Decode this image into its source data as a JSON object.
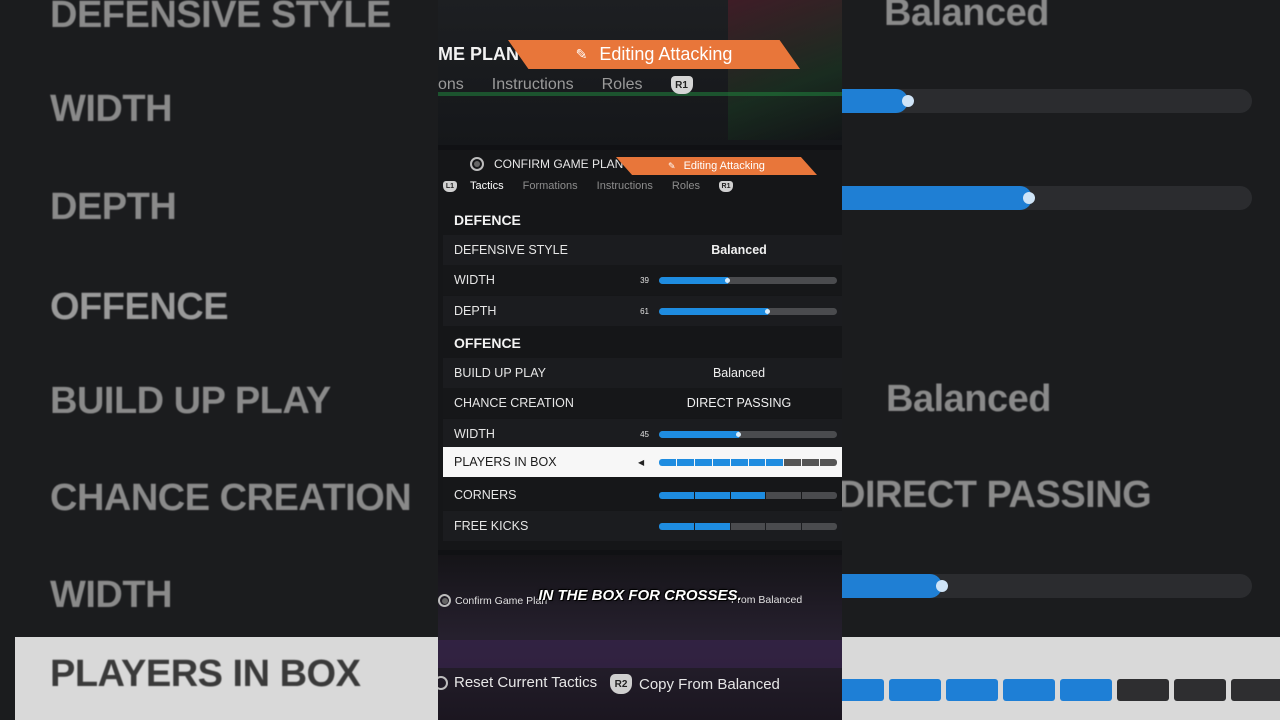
{
  "background_left": {
    "labels": [
      "DEFENSIVE STYLE",
      "WIDTH",
      "DEPTH",
      "OFFENCE",
      "BUILD UP PLAY",
      "CHANCE CREATION",
      "WIDTH",
      "PLAYERS IN BOX"
    ]
  },
  "background_right": {
    "values": [
      "Balanced",
      "Balanced",
      "DIRECT PASSING"
    ]
  },
  "top_zoom": {
    "title": "ME PLAN",
    "badge": "Editing Attacking",
    "tabs": [
      "ons",
      "Instructions",
      "Roles"
    ],
    "r1": "R1"
  },
  "header": {
    "confirm_label": "CONFIRM GAME PLAN",
    "badge": "Editing Attacking"
  },
  "tabs": {
    "l1": "L1",
    "r1": "R1",
    "items": [
      "Tactics",
      "Formations",
      "Instructions",
      "Roles"
    ],
    "active": 0
  },
  "defence": {
    "title": "DEFENCE",
    "rows": [
      {
        "label": "DEFENSIVE STYLE",
        "type": "value",
        "value": "Balanced"
      },
      {
        "label": "WIDTH",
        "type": "slider",
        "value": "39",
        "fraction": 0.39
      },
      {
        "label": "DEPTH",
        "type": "slider",
        "value": "61",
        "fraction": 0.61
      }
    ]
  },
  "offence": {
    "title": "OFFENCE",
    "rows": [
      {
        "label": "BUILD UP PLAY",
        "type": "value",
        "value": "Balanced"
      },
      {
        "label": "CHANCE CREATION",
        "type": "value",
        "value": "DIRECT PASSING"
      },
      {
        "label": "WIDTH",
        "type": "slider",
        "value": "45",
        "fraction": 0.45
      },
      {
        "label": "PLAYERS IN BOX",
        "type": "segments",
        "filled": 7,
        "total": 10,
        "selected": true
      },
      {
        "label": "CORNERS",
        "type": "segments",
        "filled": 3,
        "total": 5
      },
      {
        "label": "FREE KICKS",
        "type": "segments",
        "filled": 2,
        "total": 5
      }
    ]
  },
  "bottom_small": {
    "confirm": "Confirm Game Plan",
    "copy": "From Balanced"
  },
  "caption": "IN THE BOX FOR CROSSES.",
  "bottom_big": {
    "reset": "Reset Current Tactics",
    "r2": "R2",
    "copy": "Copy From Balanced"
  },
  "colors": {
    "accent": "#e8763a",
    "bar": "#1e8ce0",
    "selected_row": "#f7f7f7"
  }
}
